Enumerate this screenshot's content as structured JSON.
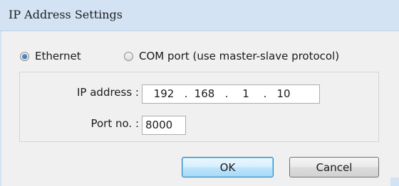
{
  "window": {
    "title": "IP Address Settings"
  },
  "connection": {
    "ethernet_label": "Ethernet",
    "ethernet_selected": true,
    "com_label": "COM port (use master-slave protocol)",
    "com_selected": false
  },
  "settings": {
    "ip_label": "IP address :",
    "ip_octets": [
      "192",
      "168",
      "1",
      "10"
    ],
    "ip_separator": ".",
    "port_label": "Port no. :",
    "port_value": "8000"
  },
  "buttons": {
    "ok_label": "OK",
    "cancel_label": "Cancel"
  },
  "colors": {
    "titlebar": "#d3e3f4",
    "dialog_background": "#f0f0f0",
    "default_button_border": "#3c7fb1"
  }
}
